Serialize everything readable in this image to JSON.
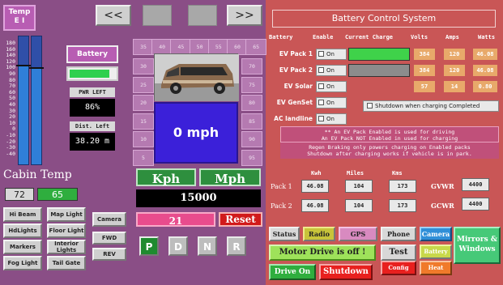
{
  "left": {
    "temp": {
      "title": "Temp",
      "sub": "E  I",
      "scale": [
        "180",
        "160",
        "140",
        "120",
        "100",
        "90",
        "80",
        "70",
        "60",
        "50",
        "40",
        "30",
        "20",
        "10",
        "0",
        "-10",
        "-20",
        "-30",
        "-40"
      ]
    },
    "cabin": {
      "title": "Cabin Temp",
      "setpoint": "72",
      "current": "65"
    },
    "nav": {
      "prev": "<<",
      "next": ">>"
    },
    "battery": {
      "label": "Battery",
      "level_pct": 88
    },
    "pwr_left": {
      "label": "PWR LEFT",
      "value": "86%"
    },
    "dist_left": {
      "label": "Dist. Left",
      "value": "38.20 m"
    },
    "speed_ticks": {
      "top": [
        "35",
        "40",
        "45",
        "50",
        "55",
        "60",
        "65"
      ],
      "left": [
        "30",
        "25",
        "20",
        "15",
        "10",
        "5"
      ],
      "right": [
        "70",
        "75",
        "80",
        "85",
        "90",
        "95"
      ]
    },
    "speed": "0 mph",
    "units": {
      "kph": "Kph",
      "mph": "Mph"
    },
    "odometer": "15000",
    "trip": "21",
    "reset": "Reset",
    "lights": {
      "hi_beam": "Hi Beam",
      "map_light": "Map Light",
      "hdlights": "HdLights",
      "floor_light": "Floor Light",
      "markers": "Markers",
      "interior_lights": "Interior Lights",
      "fog_light": "Fog Light",
      "tail_gate": "Tail Gate"
    },
    "camera": "Camera",
    "fwd": "FWD",
    "rev": "REV",
    "gears": [
      "P",
      "D",
      "N",
      "R"
    ]
  },
  "right": {
    "title": "Battery Control System",
    "columns": {
      "battery": "Battery",
      "enable": "Enable",
      "charge": "Current Charge",
      "volts": "Volts",
      "amps": "Amps",
      "watts": "Watts"
    },
    "packs": [
      {
        "label": "EV Pack 1",
        "enable": "On",
        "charge_color": "#3fd24a",
        "volts": "384",
        "amps": "120",
        "watts": "46.08"
      },
      {
        "label": "EV Pack 2",
        "enable": "On",
        "charge_color": "#8c8c8c",
        "volts": "384",
        "amps": "120",
        "watts": "46.08"
      },
      {
        "label": "EV Solar",
        "enable": "On",
        "volts": "57",
        "amps": "14",
        "watts": "0.80"
      },
      {
        "label": "EV GenSet",
        "enable": "On"
      },
      {
        "label": "AC landline",
        "enable": "On"
      }
    ],
    "shutdown_check": "Shutdown when charging Completed",
    "note1_line1": "** An EV Pack Enabled is used for driving",
    "note1_line2": "An EV Pack NOT Enabled in used for charging",
    "note2_line1": "Regen Braking only powers charging on Enabled packs",
    "note2_line2": "Shutdown after charging works if vehicle is in park.",
    "sub_columns": {
      "kwh": "Kwh",
      "miles": "Miles",
      "kms": "Kms"
    },
    "pack_rows": [
      {
        "label": "Pack 1",
        "kwh": "46.08",
        "miles": "104",
        "kms": "173",
        "g_label": "GVWR",
        "g_value": "4400"
      },
      {
        "label": "Pack 2",
        "kwh": "46.08",
        "miles": "104",
        "kms": "173",
        "g_label": "GCWR",
        "g_value": "4400"
      }
    ],
    "buttons": {
      "status": "Status",
      "radio": "Radio",
      "gps": "GPS",
      "phone": "Phone",
      "camera": "Camera",
      "mirrors": "Mirrors & Windows",
      "motor": "Motor Drive is off !",
      "test": "Test",
      "battery": "Battery",
      "drive_on": "Drive On",
      "shutdown": "Shutdown",
      "config": "Config",
      "heat": "Heat"
    }
  }
}
